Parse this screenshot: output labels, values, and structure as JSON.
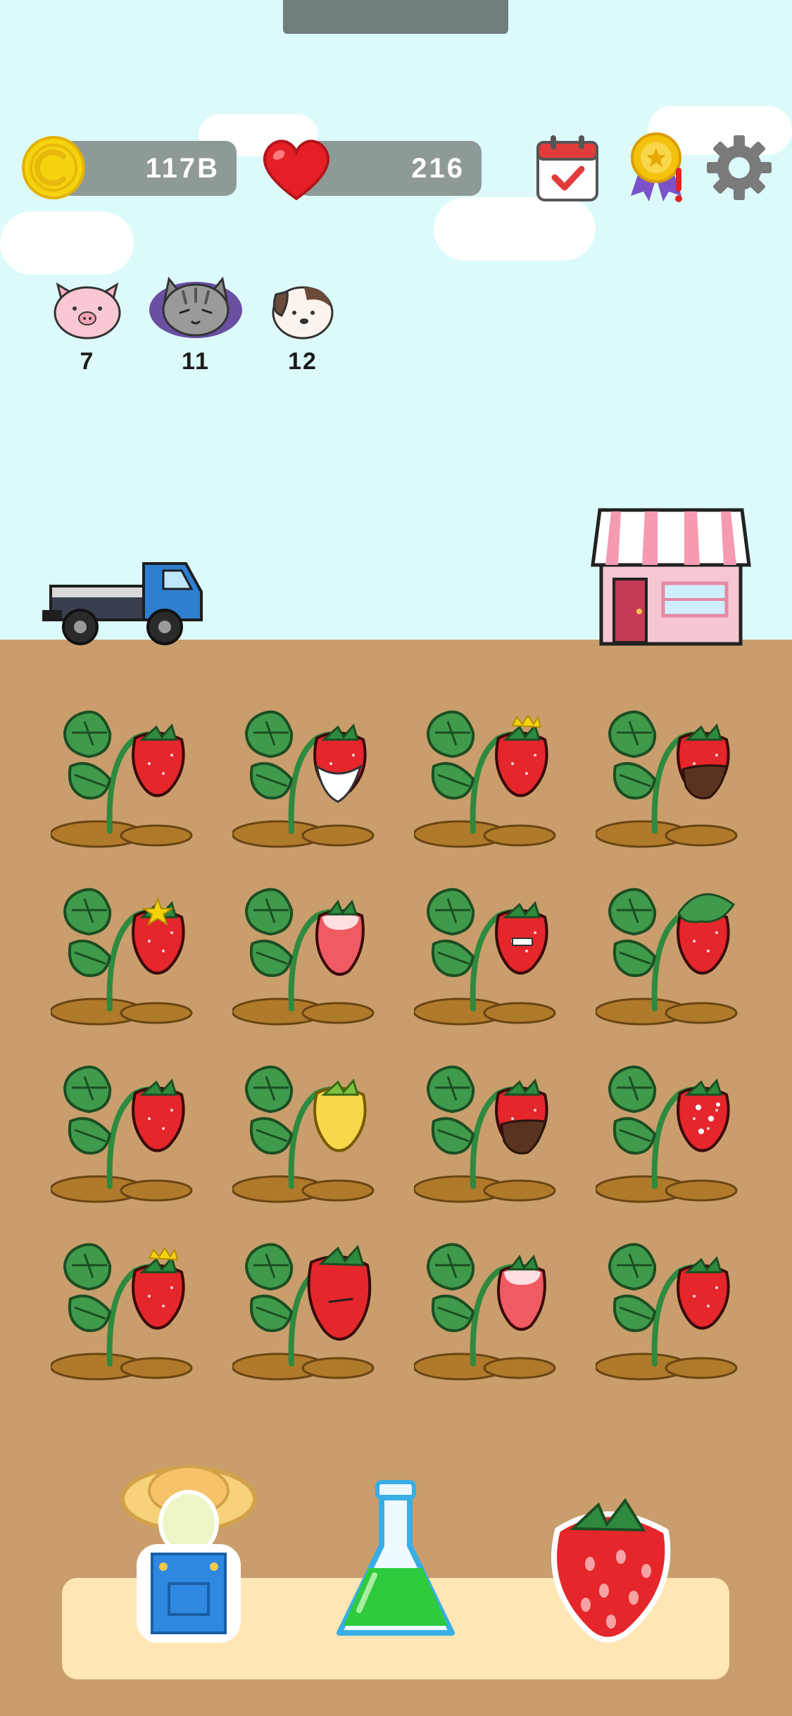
{
  "hud": {
    "coins": "117B",
    "hearts": "216"
  },
  "pets": [
    {
      "name": "pig",
      "count": "7"
    },
    {
      "name": "cat",
      "count": "11"
    },
    {
      "name": "dog",
      "count": "12"
    }
  ],
  "colors": {
    "sky": "#ddfafa",
    "ground": "#c99e6c",
    "pill": "#8e9a98",
    "tray": "#ffe6b5"
  },
  "garden": {
    "rows": [
      [
        "plain",
        "cream",
        "crown-small",
        "chocolate"
      ],
      [
        "star",
        "pale",
        "grin",
        "leafy"
      ],
      [
        "plain-dark",
        "yellow",
        "chocolate",
        "sparkle"
      ],
      [
        "mustache-crown",
        "big",
        "pale",
        "smile"
      ]
    ]
  },
  "bottom_bar": {
    "items": [
      "farmer-icon",
      "flask-icon",
      "strawberry-icon"
    ]
  }
}
